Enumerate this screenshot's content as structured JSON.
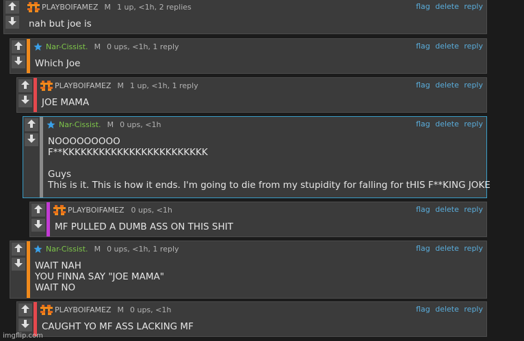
{
  "comments": [
    {
      "user": "PLAYBOIFAMEZ",
      "badge": "M",
      "meta": "1 up, <1h, 2 replies",
      "lines": [
        "nah but joe is"
      ],
      "bar_color": "#3b3b3b",
      "icon": "pixel-face-avatar"
    },
    {
      "user": "Nar-Cissist.",
      "badge": "M",
      "meta": "0 ups, <1h, 1 reply",
      "lines": [
        "Which Joe"
      ],
      "bar_color": "#f08a1c",
      "icon": "star-icon"
    },
    {
      "user": "PLAYBOIFAMEZ",
      "badge": "M",
      "meta": "1 up, <1h, 1 reply",
      "lines": [
        "JOE MAMA"
      ],
      "bar_color": "#e5484d",
      "icon": "pixel-face-avatar"
    },
    {
      "user": "Nar-Cissist.",
      "badge": "M",
      "meta": "0 ups, <1h",
      "lines": [
        "NOOOOOOOOO",
        "F**KKKKKKKKKKKKKKKKKKKKKKKK",
        "",
        "Guys",
        "This is it. This is how it ends. I'm going to die from my stupidity for falling for tHIS F**KING JOKE"
      ],
      "bar_color": "#8a8a8a",
      "icon": "star-icon"
    },
    {
      "user": "PLAYBOIFAMEZ",
      "badge": "",
      "meta": "0 ups, <1h",
      "lines": [
        "MF PULLED A DUMB ASS ON THIS SHIT"
      ],
      "bar_color": "#c23bd4",
      "icon": "pixel-face-avatar"
    },
    {
      "user": "Nar-Cissist.",
      "badge": "M",
      "meta": "0 ups, <1h, 1 reply",
      "lines": [
        "WAIT NAH",
        "YOU FINNA SAY \"JOE MAMA\"",
        "WAIT NO"
      ],
      "bar_color": "#f08a1c",
      "icon": "star-icon"
    },
    {
      "user": "PLAYBOIFAMEZ",
      "badge": "M",
      "meta": "0 ups, <1h",
      "lines": [
        "CAUGHT YO MF ASS LACKING MF"
      ],
      "bar_color": "#e5484d",
      "icon": "pixel-face-avatar"
    }
  ],
  "actions": {
    "flag": "flag",
    "delete": "delete",
    "reply": "reply"
  },
  "watermark": "imgflip.com",
  "colors": {
    "link": "#5aaddb",
    "narname": "#7ec64a",
    "highlight_border": "#3a9fc9"
  }
}
